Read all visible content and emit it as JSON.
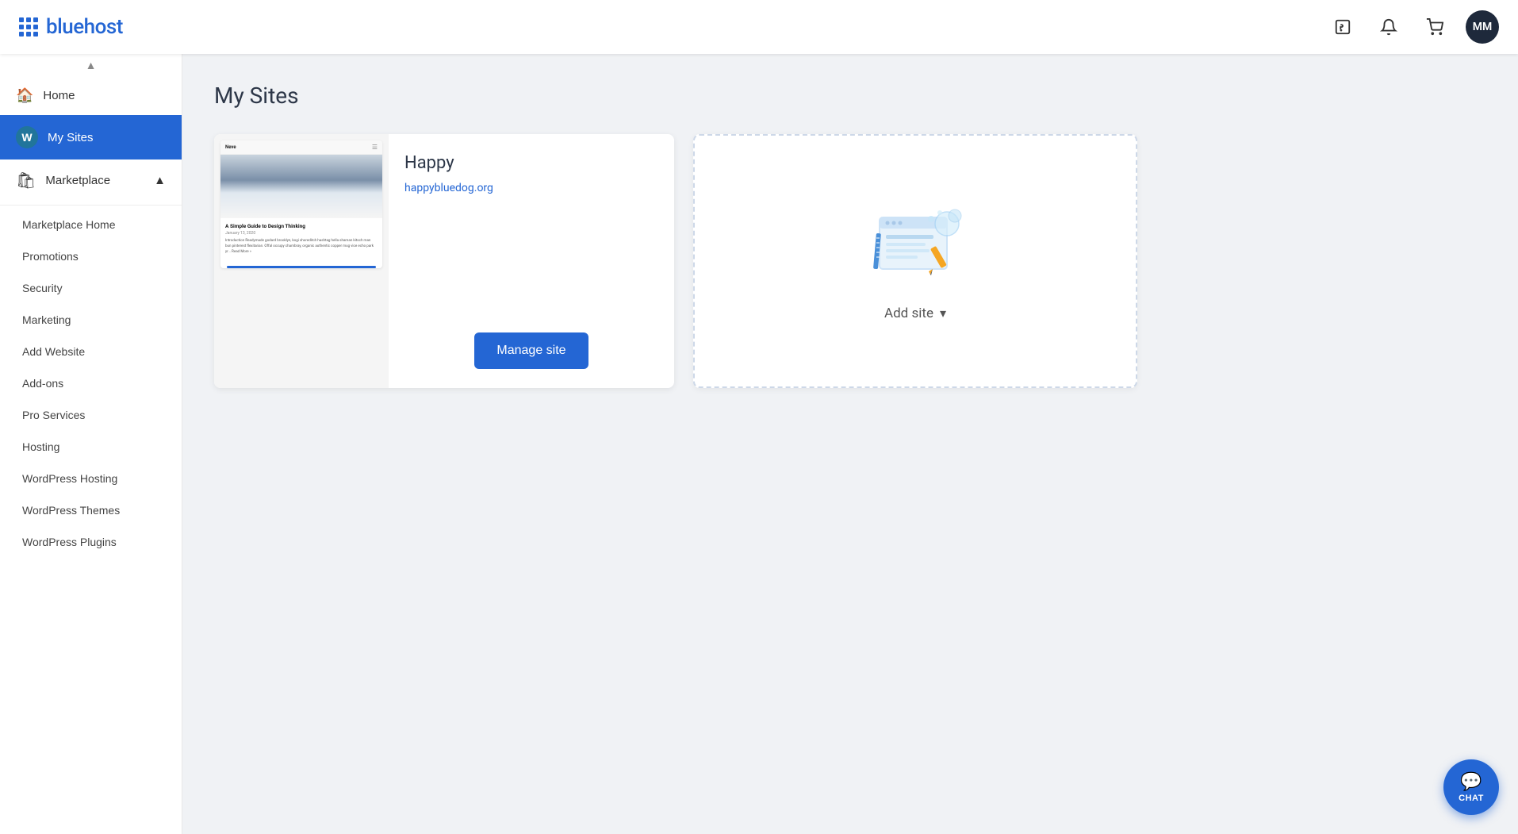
{
  "header": {
    "logo_text": "bluehost",
    "avatar_initials": "MM"
  },
  "sidebar": {
    "home_label": "Home",
    "my_sites_label": "My Sites",
    "marketplace_label": "Marketplace",
    "marketplace_chevron": "▲",
    "sub_items": [
      {
        "label": "Marketplace Home"
      },
      {
        "label": "Promotions"
      },
      {
        "label": "Security"
      },
      {
        "label": "Marketing"
      },
      {
        "label": "Add Website"
      },
      {
        "label": "Add-ons"
      },
      {
        "label": "Pro Services"
      },
      {
        "label": "Hosting"
      },
      {
        "label": "WordPress Hosting"
      },
      {
        "label": "WordPress Themes"
      },
      {
        "label": "WordPress Plugins"
      }
    ]
  },
  "main": {
    "page_title": "My Sites",
    "site": {
      "name": "Happy",
      "url": "happybluedog.org",
      "manage_btn": "Manage site",
      "preview": {
        "theme": "Neve",
        "heading": "A Simple Guide to Design Thinking",
        "date": "January 13, 2020",
        "body": "Introduction Readymade godard brooklyn, kogi shoreditch hashtag hella shaman kitsch man bun pinterest flexitarian. Offal occupy chambray, organic authentic copper mug vice echo park yr... Read More »"
      }
    },
    "add_site": {
      "label": "Add site",
      "chevron": "▾"
    }
  },
  "chat": {
    "label": "CHAT"
  }
}
